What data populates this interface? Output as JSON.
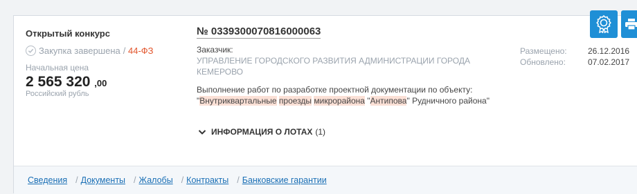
{
  "card": {
    "procedure_type": "Открытый конкурс",
    "status": "Закупка завершена",
    "law_separator": "/",
    "law": "44-ФЗ",
    "price_label": "Начальная цена",
    "price_main": "2 565 320",
    "price_cents": ",00",
    "currency": "Российский рубль",
    "reg_number": "№ 0339300070816000063",
    "customer_label": "Заказчик:",
    "customer_name": "УПРАВЛЕНИЕ ГОРОДСКОГО РАЗВИТИЯ АДМИНИСТРАЦИИ ГОРОДА КЕМЕРОВО",
    "description": {
      "t1": "Выполнение работ по разработке проектной документации по объекту: \"",
      "h1": "Внутриквартальные",
      "t2": " ",
      "h2": "проезды",
      "t3": " ",
      "h3": "микрорайона",
      "t4": " \"",
      "h4": "Антипова",
      "t5": "\" Рудничного района\""
    },
    "lots_label": "ИНФОРМАЦИЯ О ЛОТАХ",
    "lots_count": "(1)",
    "posted_label": "Размещено:",
    "posted_date": "26.12.2016",
    "updated_label": "Обновлено:",
    "updated_date": "07.02.2017"
  },
  "tabs": [
    {
      "label": "Сведения"
    },
    {
      "label": "Документы"
    },
    {
      "label": "Жалобы"
    },
    {
      "label": "Контракты"
    },
    {
      "label": "Банковские гарантии"
    }
  ],
  "tab_separator": "/",
  "icons": {
    "certificate": "award-icon",
    "print": "printer-icon",
    "chevron": "chevron-down-icon",
    "check": "check-circle-icon"
  },
  "colors": {
    "accent": "#1f8fd6",
    "law": "#e2552c",
    "link": "#1a6fb5",
    "highlight": "#fbe0d6"
  }
}
